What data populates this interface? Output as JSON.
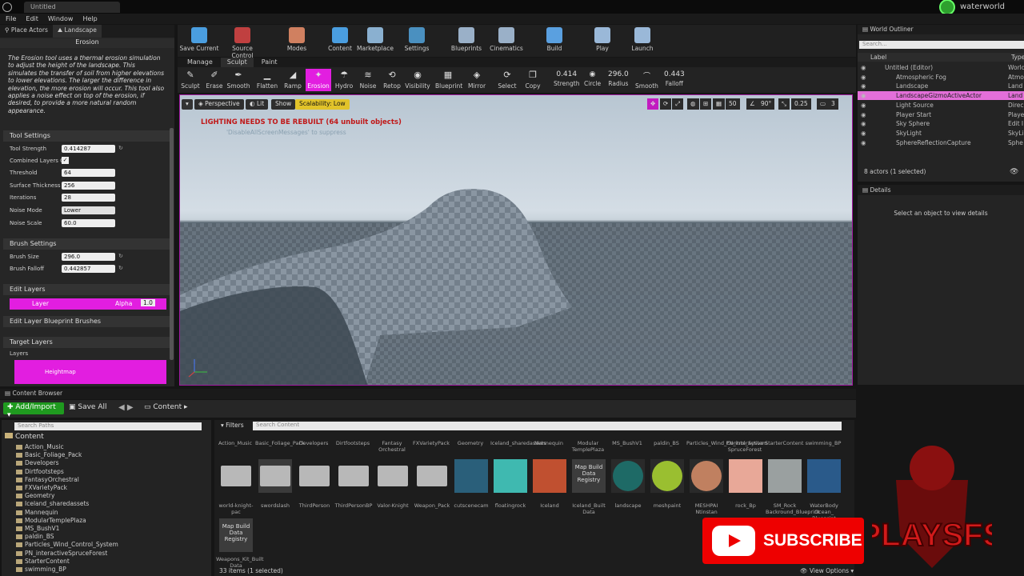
{
  "window": {
    "tab_title": "Untitled",
    "project": "waterworld"
  },
  "menu": [
    "File",
    "Edit",
    "Window",
    "Help"
  ],
  "left_panel": {
    "tabs": [
      "Place Actors",
      "Landscape"
    ],
    "mode_title": "Erosion",
    "description": "The Erosion tool uses a thermal erosion simulation to adjust the height of the landscape. This simulates the transfer of soil from higher elevations to lower elevations. The larger the difference in elevation, the more erosion will occur. This tool also applies a noise effect on top of the erosion, if desired, to provide a more natural random appearance.",
    "tool_settings": {
      "header": "Tool Settings",
      "rows": [
        {
          "label": "Tool Strength",
          "value": "0.414287"
        },
        {
          "label": "Combined Layers O",
          "value": "✓"
        },
        {
          "label": "Threshold",
          "value": "64"
        },
        {
          "label": "Surface Thickness",
          "value": "256"
        },
        {
          "label": "Iterations",
          "value": "28"
        },
        {
          "label": "Noise Mode",
          "value": "Lower"
        },
        {
          "label": "Noise Scale",
          "value": "60.0"
        }
      ]
    },
    "brush_settings": {
      "header": "Brush Settings",
      "rows": [
        {
          "label": "Brush Size",
          "value": "296.0"
        },
        {
          "label": "Brush Falloff",
          "value": "0.442857"
        }
      ]
    },
    "edit_layers": {
      "header": "Edit Layers",
      "layer_name": "Layer",
      "alpha_label": "Alpha",
      "alpha_value": "1.0"
    },
    "blueprint_brushes": "Edit Layer Blueprint Brushes",
    "target_layers": {
      "header": "Target Layers",
      "sub": "Layers",
      "heightmap": "Heightmap"
    }
  },
  "toolbar": [
    {
      "label": "Save Current",
      "color": "#4a9ee0"
    },
    {
      "label": "Source Control",
      "color": "#c04040"
    },
    {
      "label": "Modes",
      "color": "#d08060"
    },
    {
      "label": "Content",
      "color": "#4a9ee0"
    },
    {
      "label": "Marketplace",
      "color": "#8ab0d0"
    },
    {
      "label": "Settings",
      "color": "#4a90c0"
    },
    {
      "label": "Blueprints",
      "color": "#9ab0c8"
    },
    {
      "label": "Cinematics",
      "color": "#9ab0c8"
    },
    {
      "label": "Build",
      "color": "#5aa0e0"
    },
    {
      "label": "Play",
      "color": "#9ab8d8"
    },
    {
      "label": "Launch",
      "color": "#9ab8d8"
    }
  ],
  "mode_tabs": [
    "Manage",
    "Sculpt",
    "Paint"
  ],
  "sculpt_tools": [
    {
      "label": "Sculpt",
      "glyph": "✎"
    },
    {
      "label": "Erase",
      "glyph": "✐"
    },
    {
      "label": "Smooth",
      "glyph": "✒"
    },
    {
      "label": "Flatten",
      "glyph": "▁"
    },
    {
      "label": "Ramp",
      "glyph": "◢"
    },
    {
      "label": "Erosion",
      "glyph": "✦"
    },
    {
      "label": "Hydro",
      "glyph": "☂"
    },
    {
      "label": "Noise",
      "glyph": "≋"
    },
    {
      "label": "Retop",
      "glyph": "⟲"
    },
    {
      "label": "Visibility",
      "glyph": "◉"
    },
    {
      "label": "Blueprint",
      "glyph": "▦"
    },
    {
      "label": "Mirror",
      "glyph": "◈"
    },
    {
      "label": "Select",
      "glyph": "⟳"
    },
    {
      "label": "Copy",
      "glyph": "❐"
    }
  ],
  "sculpt_values": [
    {
      "value": "0.414",
      "label": "Strength"
    },
    {
      "value": "◉",
      "label": "Circle"
    },
    {
      "value": "296.0",
      "label": "Radius"
    },
    {
      "value": "⌒",
      "label": "Smooth"
    },
    {
      "value": "0.443",
      "label": "Falloff"
    }
  ],
  "viewport": {
    "perspective": "Perspective",
    "lit": "Lit",
    "show": "Show",
    "scalability": "Scalability: Low",
    "warning": "LIGHTING NEEDS TO BE REBUILT (64 unbuilt objects)",
    "suppress": "'DisableAllScreenMessages' to suppress",
    "grid": "50",
    "angle": "90°",
    "scale": "0.25",
    "cams": "3"
  },
  "outliner": {
    "title": "World Outliner",
    "search": "Search...",
    "col_label": "Label",
    "col_type": "Type",
    "rows": [
      {
        "name": "Untitled (Editor)",
        "type": "World",
        "indent": 20
      },
      {
        "name": "Atmospheric Fog",
        "type": "Atmo",
        "indent": 34
      },
      {
        "name": "Landscape",
        "type": "Land",
        "indent": 34
      },
      {
        "name": "LandscapeGizmoActiveActor",
        "type": "Land",
        "indent": 34,
        "selected": true
      },
      {
        "name": "Light Source",
        "type": "Direc",
        "indent": 34
      },
      {
        "name": "Player Start",
        "type": "Playe",
        "indent": 34
      },
      {
        "name": "Sky Sphere",
        "type": "Edit I",
        "indent": 34
      },
      {
        "name": "SkyLight",
        "type": "SkyLi",
        "indent": 34
      },
      {
        "name": "SphereReflectionCapture",
        "type": "Sphe",
        "indent": 34
      }
    ],
    "footer": "8 actors (1 selected)"
  },
  "details": {
    "title": "Details",
    "message": "Select an object to view details"
  },
  "content_browser": {
    "tab": "Content Browser",
    "add_import": "Add/Import",
    "save_all": "Save All",
    "crumb": "Content",
    "search_paths": "Search Paths",
    "filters": "Filters",
    "search_content": "Search Content",
    "root": "Content",
    "folders": [
      "Action_Music",
      "Basic_Foliage_Pack",
      "Developers",
      "Dirtfootsteps",
      "FantasyOrchestral",
      "FXVarietyPack",
      "Geometry",
      "Iceland_sharedassets",
      "Mannequin",
      "ModularTemplePlaza",
      "MS_BushV1",
      "paldin_BS",
      "Particles_Wind_Control_System",
      "PN_interactiveSpruceForest",
      "StarterContent",
      "swimming_BP"
    ],
    "top_names": [
      "Action_Music",
      "Basic_Foliage_Pack",
      "Developers",
      "Dirtfootsteps",
      "Fantasy Orchestral",
      "FXVarietyPack",
      "Geometry",
      "Iceland_sharedassets",
      "Mannequin",
      "Modular TemplePlaza",
      "MS_BushV1",
      "paldin_BS",
      "Particles_Wind_Control_System",
      "PN_interactive SpruceForest",
      "StarterContent",
      "swimming_BP"
    ],
    "assets": [
      {
        "name": "world-knight-pac",
        "kind": "folder",
        "color": "#b8b8b8"
      },
      {
        "name": "swordslash",
        "kind": "folder",
        "color": "#b8b8b8"
      },
      {
        "name": "ThirdPerson",
        "kind": "folder",
        "color": "#b8b8b8"
      },
      {
        "name": "ThirdPersonBP",
        "kind": "folder",
        "color": "#b8b8b8"
      },
      {
        "name": "Valor-Knight",
        "kind": "folder",
        "color": "#b8b8b8"
      },
      {
        "name": "Weapon_Pack",
        "kind": "folder",
        "color": "#b8b8b8"
      },
      {
        "name": "cutscenecam",
        "kind": "img",
        "color": "#2a5f7a"
      },
      {
        "name": "floatingrock",
        "kind": "img",
        "color": "#3fb9b0"
      },
      {
        "name": "Iceland",
        "kind": "img",
        "color": "#c05030"
      },
      {
        "name": "Iceland_Built Data",
        "kind": "text",
        "color": "#3a3a3a",
        "text": "Map Build Data Registry"
      },
      {
        "name": "landscape",
        "kind": "circle",
        "color": "#1e6a66"
      },
      {
        "name": "meshpaint",
        "kind": "circle",
        "color": "#9abf30"
      },
      {
        "name": "MESHPAI Ntinstan",
        "kind": "circle",
        "color": "#c08060"
      },
      {
        "name": "rock_Bp",
        "kind": "img",
        "color": "#e8a898"
      },
      {
        "name": "SM_Rock Backround_Blueprint",
        "kind": "img",
        "color": "#9aa0a0"
      },
      {
        "name": "WaterBody Ocean_ Blueprint",
        "kind": "img",
        "color": "#2a5a8a"
      }
    ],
    "second_row": {
      "name": "Weapons_Kit_Built Data",
      "text": "Map Build Data Registry"
    },
    "status": "33 items (1 selected)",
    "view_options": "View Options"
  },
  "overlay": {
    "subscribe": "SUBSCRIBE",
    "channel": "JESS PLAYSFS",
    "brand_red": "#e00000"
  }
}
